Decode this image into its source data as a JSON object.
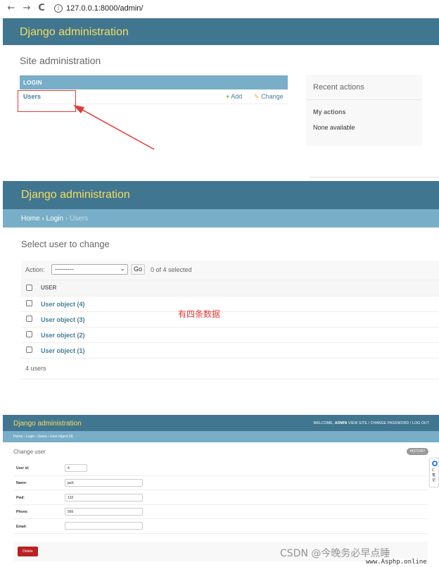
{
  "browser": {
    "back_icon": "←",
    "forward_icon": "→",
    "reload_icon": "C",
    "info_icon": "i",
    "url": "127.0.0.1:8000/admin/"
  },
  "index": {
    "title": "Django administration",
    "page_title": "Site administration",
    "module_caption": "LOGIN",
    "model_name": "Users",
    "add_label": "Add",
    "change_label": "Change",
    "recent": {
      "title": "Recent actions",
      "my_actions": "My actions",
      "empty": "None available"
    }
  },
  "changelist": {
    "title": "Django administration",
    "breadcrumbs": {
      "home": "Home",
      "app": "Login",
      "current": "Users"
    },
    "page_title": "Select user to change",
    "action_label": "Action:",
    "action_value": "---------",
    "go_label": "Go",
    "selected": "0 of 4 selected",
    "column_user": "USER",
    "rows": [
      "User object (4)",
      "User object (3)",
      "User object (2)",
      "User object (1)"
    ],
    "count": "4 users",
    "annotation": "有四条数据"
  },
  "changeform": {
    "title": "Django administration",
    "user_tools": {
      "welcome": "WELCOME,",
      "user": "ADMIN",
      "links": "VIEW SITE / CHANGE PASSWORD / LOG OUT"
    },
    "breadcrumbs": "Home › Login › Users › User object (4)",
    "page_title": "Change user",
    "history_label": "HISTORY",
    "fields": [
      {
        "label": "User id:",
        "value": "4"
      },
      {
        "label": "Name:",
        "value": "jack"
      },
      {
        "label": "Pwd:",
        "value": "132"
      },
      {
        "label": "Phone:",
        "value": "566"
      },
      {
        "label": "Email:",
        "value": ""
      }
    ],
    "delete_label": "Delete"
  },
  "side_widget": {
    "text": "C 笔 记"
  },
  "watermark": {
    "text": "CSDN @今晚务必早点睡",
    "url": "www.Asphp.online"
  },
  "colors": {
    "header": "#417690",
    "title": "#f5dd5d",
    "breadcrumb": "#79aec8",
    "link": "#447e9b",
    "annotation": "#e53935"
  }
}
